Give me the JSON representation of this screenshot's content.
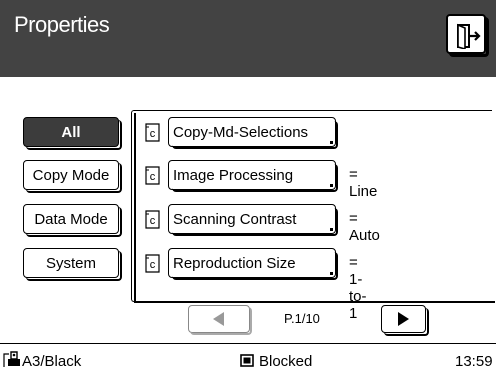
{
  "header": {
    "title": "Properties",
    "exit_icon": "exit-icon"
  },
  "categories": [
    {
      "label": "All",
      "active": true
    },
    {
      "label": "Copy Mode",
      "active": false
    },
    {
      "label": "Data Mode",
      "active": false
    },
    {
      "label": "System",
      "active": false
    }
  ],
  "items": [
    {
      "icon": "c",
      "label": "Copy-Md-Selections",
      "value": ""
    },
    {
      "icon": "c",
      "label": "Image Processing",
      "value": "= Line"
    },
    {
      "icon": "c",
      "label": "Scanning Contrast",
      "value": "= Auto"
    },
    {
      "icon": "c",
      "label": "Reproduction Size",
      "value": "= 1-to-1"
    }
  ],
  "pager": {
    "page_label": "P.1/10",
    "prev_icon": "left-arrow-icon",
    "next_icon": "right-arrow-icon"
  },
  "status": {
    "paper": "A3/Black",
    "lock": "Blocked",
    "time": "13:59"
  }
}
